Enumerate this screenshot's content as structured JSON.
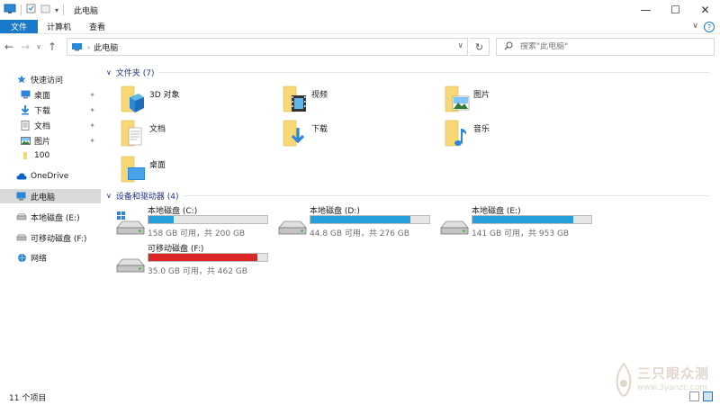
{
  "window": {
    "title": "此电脑",
    "minimize_glyph": "—",
    "maximize_glyph": "☐",
    "close_glyph": "✕"
  },
  "ribbon": {
    "tabs": [
      {
        "label": "文件"
      },
      {
        "label": "计算机"
      },
      {
        "label": "查看"
      }
    ],
    "help": "?"
  },
  "address": {
    "path": "此电脑",
    "refresh_glyph": "↻"
  },
  "search": {
    "placeholder": "搜索\"此电脑\""
  },
  "nav": {
    "quick_access": "快速访问",
    "items": [
      {
        "label": "桌面",
        "icon": "desktop-icon",
        "pinned": true
      },
      {
        "label": "下载",
        "icon": "download-icon",
        "pinned": true
      },
      {
        "label": "文档",
        "icon": "documents-icon",
        "pinned": true
      },
      {
        "label": "图片",
        "icon": "pictures-icon",
        "pinned": true
      },
      {
        "label": "100",
        "icon": "folder-icon",
        "pinned": false
      }
    ],
    "onedrive": "OneDrive",
    "this_pc": "此电脑",
    "drive_e": "本地磁盘 (E:)",
    "drive_f": "可移动磁盘 (F:)",
    "network": "网络"
  },
  "folders": {
    "header": "文件夹 (7)",
    "items": [
      {
        "label": "3D 对象",
        "icon": "3d-objects-icon"
      },
      {
        "label": "视频",
        "icon": "videos-icon"
      },
      {
        "label": "图片",
        "icon": "pictures-icon"
      },
      {
        "label": "文档",
        "icon": "documents-icon"
      },
      {
        "label": "下载",
        "icon": "downloads-icon"
      },
      {
        "label": "音乐",
        "icon": "music-icon"
      },
      {
        "label": "桌面",
        "icon": "desktop-icon"
      }
    ]
  },
  "drives": {
    "header": "设备和驱动器 (4)",
    "items": [
      {
        "name": "本地磁盘 (C:)",
        "info": "158 GB 可用，共 200 GB",
        "used_fraction": 0.21,
        "status_color": "#26a0da"
      },
      {
        "name": "本地磁盘 (D:)",
        "info": "44.8 GB 可用，共 276 GB",
        "used_fraction": 0.84,
        "status_color": "#26a0da"
      },
      {
        "name": "本地磁盘 (E:)",
        "info": "141 GB 可用，共 953 GB",
        "used_fraction": 0.85,
        "status_color": "#26a0da"
      },
      {
        "name": "可移动磁盘 (F:)",
        "info": "35.0 GB 可用，共 462 GB",
        "used_fraction": 0.92,
        "status_color": "#da2626"
      }
    ]
  },
  "status": {
    "count": "11 个项目"
  },
  "watermark": {
    "title": "三只眼众测",
    "url": "www.3yanzc.com"
  },
  "colors": {
    "accent": "#1979ca",
    "folder_yellow": "#f8d775",
    "drive_bar": "#26a0da",
    "drive_bar_full": "#da2626"
  }
}
